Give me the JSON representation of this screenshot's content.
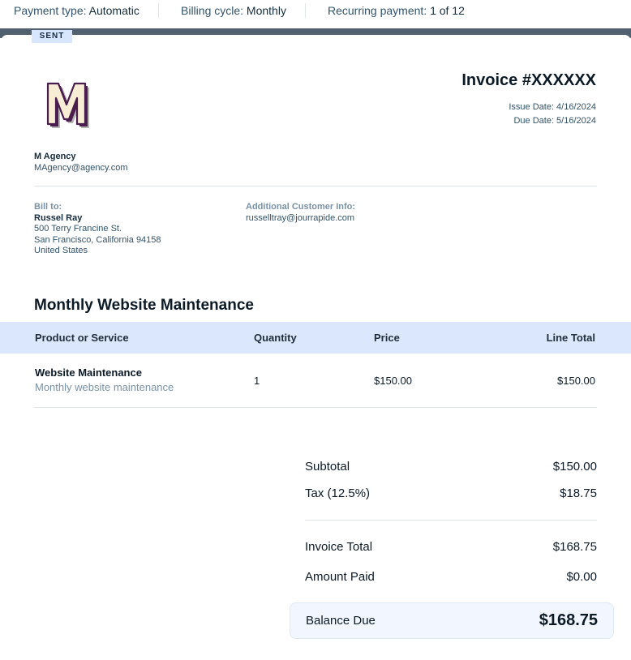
{
  "header": {
    "payment_type_label": "Payment type:",
    "payment_type_value": "Automatic",
    "billing_cycle_label": "Billing cycle:",
    "billing_cycle_value": "Monthly",
    "recurring_label": "Recurring payment:",
    "recurring_value": "1 of 12"
  },
  "invoice": {
    "status": "SENT",
    "title": "Invoice #XXXXXX",
    "issue_date": "Issue Date: 4/16/2024",
    "due_date": "Due Date: 5/16/2024",
    "logo_icon": "m-agency-logo"
  },
  "company": {
    "name": "M Agency",
    "email": "MAgency@agency.com"
  },
  "bill_to": {
    "label": "Bill to:",
    "name": "Russel Ray",
    "address_line1": "500 Terry Francine St.",
    "address_line2": "San Francisco, California 94158",
    "country": "United States"
  },
  "additional_info": {
    "label": "Additional Customer Info:",
    "email": "russelltray@jourrapide.com"
  },
  "section": {
    "title": "Monthly Website Maintenance"
  },
  "table": {
    "headers": [
      "Product or Service",
      "Quantity",
      "Price",
      "Line Total"
    ],
    "rows": [
      {
        "name": "Website Maintenance",
        "description": "Monthly website maintenance",
        "quantity": "1",
        "price": "$150.00",
        "total": "$150.00"
      }
    ]
  },
  "summary": {
    "subtotal_label": "Subtotal",
    "subtotal_value": "$150.00",
    "tax_label": "Tax (12.5%)",
    "tax_value": "$18.75",
    "invoice_total_label": "Invoice Total",
    "invoice_total_value": "$168.75",
    "amount_paid_label": "Amount Paid",
    "amount_paid_value": "$0.00",
    "balance_due_label": "Balance Due",
    "balance_due_value": "$168.75"
  },
  "colors": {
    "header_band": "#52616f",
    "table_header_bg": "#dae7fc",
    "status_badge_bg": "#d7e5ff",
    "balance_bg": "#f2f7ff",
    "logo_primary": "#4a1d4f",
    "logo_fill": "#f7ecd4"
  }
}
